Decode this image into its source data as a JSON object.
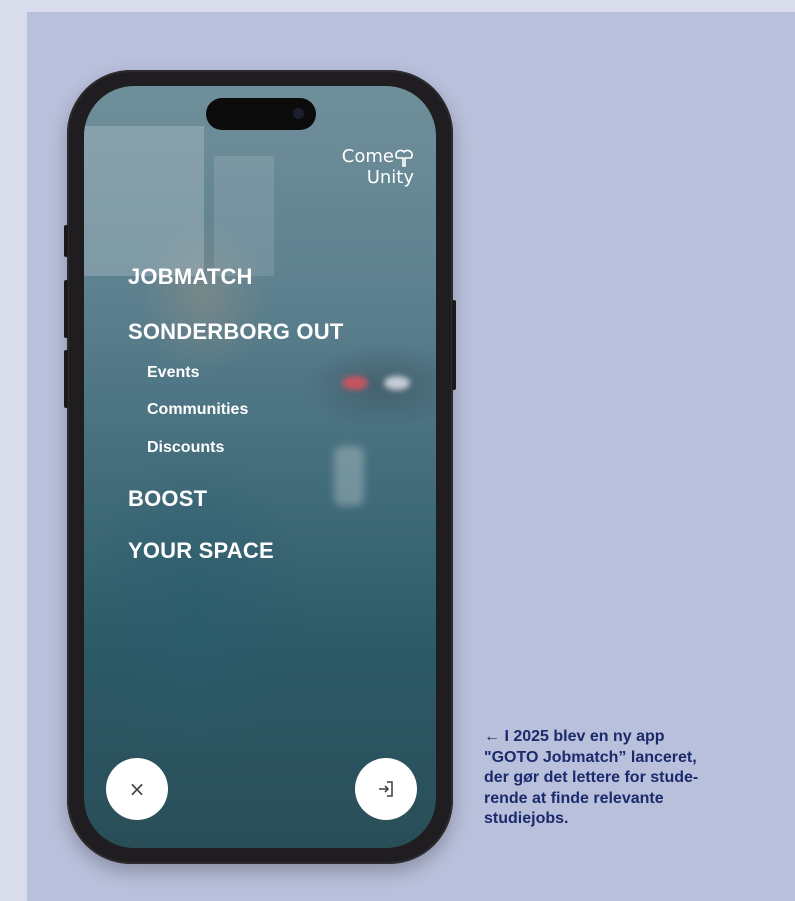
{
  "app": {
    "logo": {
      "line1": "Come",
      "line2": "Unity"
    },
    "menu": {
      "jobmatch": "JOBMATCH",
      "sonderborg_out": "SONDERBORG OUT",
      "events": "Events",
      "communities": "Communities",
      "discounts": "Discounts",
      "boost": "BOOST",
      "your_space": "YOUR SPACE"
    },
    "close_symbol": "×",
    "icons": {
      "close": "close-icon",
      "login": "login-icon",
      "logo_mark": "heart-plus-icon"
    }
  },
  "caption": {
    "arrow": "←",
    "lines": [
      "I 2025 blev en ny app",
      "\"GOTO Jobmatch” lanceret,",
      "der gør det lettere for stude-",
      "rende at finde relevante",
      "studiejobs."
    ]
  },
  "colors": {
    "background": "#b9c0dc",
    "caption_text": "#1b2a6b",
    "phone_frame": "#1f1d1f",
    "button_bg": "#ffffff"
  }
}
